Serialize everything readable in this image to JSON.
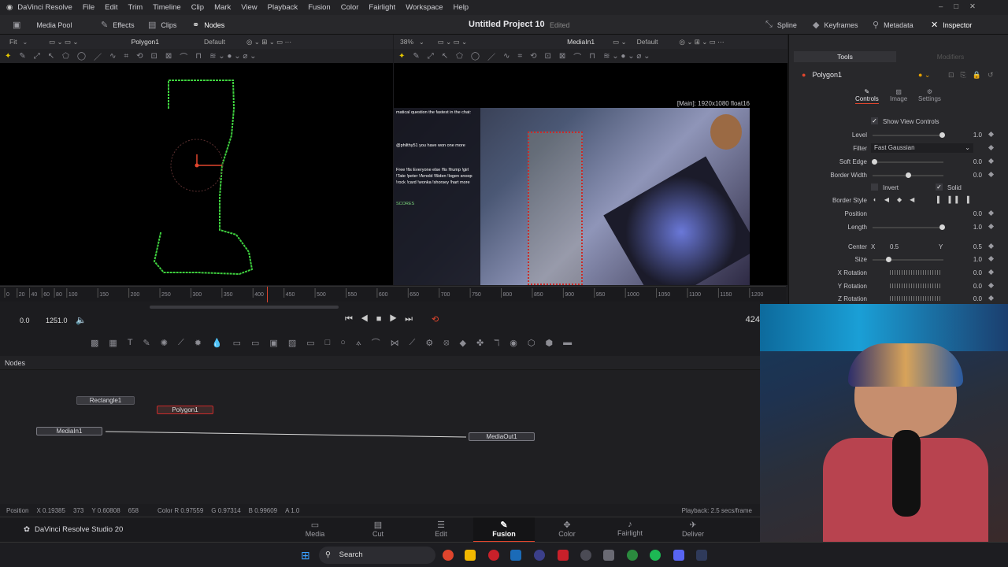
{
  "menubar": {
    "app_name": "DaVinci Resolve",
    "items": [
      "File",
      "Edit",
      "Trim",
      "Timeline",
      "Clip",
      "Mark",
      "View",
      "Playback",
      "Fusion",
      "Color",
      "Fairlight",
      "Workspace",
      "Help"
    ]
  },
  "toolbar": {
    "media_pool": "Media Pool",
    "effects": "Effects",
    "clips": "Clips",
    "nodes": "Nodes",
    "project_title": "Untitled Project 10",
    "edited": "Edited",
    "spline": "Spline",
    "keyframes": "Keyframes",
    "metadata": "Metadata",
    "inspector": "Inspector"
  },
  "viewer_left": {
    "fit": "Fit",
    "node_name": "Polygon1",
    "lut": "Default"
  },
  "viewer_right": {
    "zoom": "38%",
    "node_name": "MediaIn1",
    "lut": "Default",
    "resolution": "[Main]: 1920x1080 float16"
  },
  "video_overlay": {
    "chat_1": "matical question the fastest in the chat:",
    "chat_2": "@philthy51 you have won one more",
    "chat_3": "Free !fis Everyone else !fis !frump !girl !Tate !peter !Arnold !Biden !logen snoop !rock !card !wonka !shorsey !hart more",
    "scores": "SCORES"
  },
  "ruler": {
    "ticks": [
      "0",
      "20",
      "40",
      "60",
      "80",
      "100",
      "150",
      "200",
      "250",
      "300",
      "350",
      "400",
      "450",
      "500",
      "550",
      "600",
      "650",
      "700",
      "750",
      "800",
      "850",
      "900",
      "950",
      "1000",
      "1050",
      "1100",
      "1150",
      "1200"
    ]
  },
  "transport": {
    "start": "0.0",
    "end": "1251.0",
    "frame": "424"
  },
  "nodes_panel": {
    "title": "Nodes",
    "nodes": {
      "rectangle": "Rectangle1",
      "polygon": "Polygon1",
      "mediain": "MediaIn1",
      "mediaout": "MediaOut1"
    }
  },
  "status": {
    "position": "Position",
    "x": "X 0.19385",
    "x_px": "373",
    "y": "Y 0.60808",
    "y_px": "658",
    "color_r": "Color R 0.97559",
    "color_g": "G 0.97314",
    "color_b": "B 0.99609",
    "alpha": "A 1.0",
    "playback": "Playback: 2.5 secs/frame"
  },
  "pages": [
    {
      "label": "Media",
      "icon": "media-icon"
    },
    {
      "label": "Cut",
      "icon": "cut-icon"
    },
    {
      "label": "Edit",
      "icon": "edit-icon"
    },
    {
      "label": "Fusion",
      "icon": "fusion-icon",
      "active": true
    },
    {
      "label": "Color",
      "icon": "color-icon"
    },
    {
      "label": "Fairlight",
      "icon": "fairlight-icon"
    },
    {
      "label": "Deliver",
      "icon": "deliver-icon"
    }
  ],
  "branding": "DaVinci Resolve Studio 20",
  "inspector": {
    "tab_tools": "Tools",
    "tab_modifiers": "Modifiers",
    "node_name": "Polygon1",
    "subtab_controls": "Controls",
    "subtab_image": "Image",
    "subtab_settings": "Settings",
    "show_view_controls": "Show View Controls",
    "level_label": "Level",
    "level_value": "1.0",
    "level_fraction": 1.0,
    "filter_label": "Filter",
    "filter_value": "Fast Gaussian",
    "soft_edge_label": "Soft Edge",
    "soft_edge_value": "0.0",
    "border_width_label": "Border Width",
    "border_width_value": "0.0",
    "invert_label": "Invert",
    "solid_label": "Solid",
    "border_style_label": "Border Style",
    "position_label": "Position",
    "position_value": "0.0",
    "length_label": "Length",
    "length_value": "1.0",
    "center_label": "Center",
    "center_x_label": "X",
    "center_x_value": "0.5",
    "center_y_label": "Y",
    "center_y_value": "0.5",
    "size_label": "Size",
    "size_value": "1.0",
    "xrot_label": "X Rotation",
    "xrot_value": "0.0",
    "yrot_label": "Y Rotation",
    "yrot_value": "0.0",
    "zrot_label": "Z Rotation",
    "zrot_value": "0.0"
  },
  "taskbar": {
    "search": "Search"
  },
  "colors": {
    "accent_red": "#e0452d",
    "polygon_green": "#3ecf3e",
    "active_page": "#e0452d",
    "inspector_bg": "#28282b"
  }
}
